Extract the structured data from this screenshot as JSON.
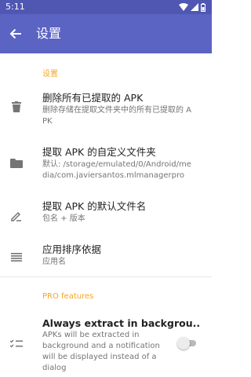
{
  "status_bar": {
    "time": "5:11"
  },
  "app_bar": {
    "title": "设置"
  },
  "sections": [
    {
      "category": "设置",
      "items": [
        {
          "icon": "trash-icon",
          "title": "删除所有已提取的 APK",
          "summary": "删除存储在提取文件夹中的所有已提取的 APK"
        },
        {
          "icon": "folder-icon",
          "title": "提取 APK 的自定义文件夹",
          "summary": "默认: /storage/emulated/0/Android/media/com.javiersantos.mlmanagerpro"
        },
        {
          "icon": "edit-icon",
          "title": "提取 APK 的默认文件名",
          "summary": "包名 + 版本"
        },
        {
          "icon": "sort-icon",
          "title": "应用排序依据",
          "summary": "应用名"
        }
      ]
    },
    {
      "category": "PRO features",
      "items": [
        {
          "icon": "checklist-icon",
          "title": "Always extract in backgrou..",
          "summary": "APKs will be extracted in background and a notification will be displayed instead of a dialog",
          "toggle": "off"
        }
      ]
    }
  ],
  "colors": {
    "status_bar": "#4f57b3",
    "app_bar": "#5b63c3",
    "accent": "#f5a623"
  }
}
